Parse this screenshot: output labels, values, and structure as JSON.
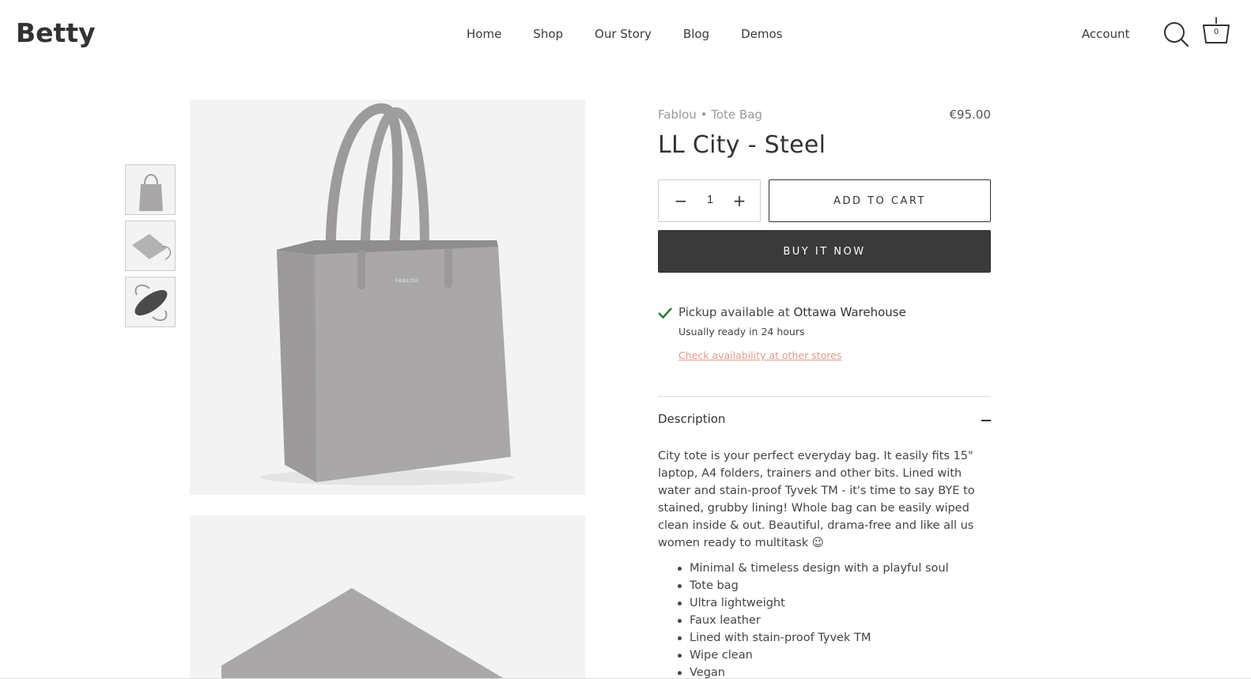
{
  "header": {
    "logo": "Betty",
    "nav": [
      "Home",
      "Shop",
      "Our Story",
      "Blog",
      "Demos"
    ],
    "account_label": "Account",
    "search_icon": "search-icon",
    "cart_icon": "cart-icon",
    "cart_count": "0"
  },
  "product": {
    "vendor": "Fablou",
    "separator": "•",
    "type": "Tote Bag",
    "price": "€95.00",
    "title": "LL City - Steel",
    "quantity": "1",
    "minus_label": "−",
    "plus_label": "+",
    "add_to_cart_label": "ADD TO CART",
    "buy_now_label": "BUY IT NOW",
    "image_logo_text": "FABLOU"
  },
  "pickup": {
    "prefix": "Pickup available at",
    "location": "Ottawa Warehouse",
    "ready": "Usually ready in 24 hours",
    "link": "Check availability at other stores",
    "check_color": "#2e7d32"
  },
  "description": {
    "title": "Description",
    "text": "City tote is your perfect everyday bag. It easily fits 15\" laptop, A4 folders, trainers and other bits. Lined with water and stain-proof Tyvek TM - it's time to say BYE to stained, grubby lining! Whole bag can be easily wiped clean inside & out. Beautiful, drama-free and like all us women ready to multitask 😉",
    "features": [
      "Minimal & timeless design with a playful soul",
      "Tote bag",
      "Ultra lightweight",
      "Faux leather",
      "Lined with stain-proof Tyvek TM",
      "Wipe clean",
      "Vegan"
    ]
  },
  "colors": {
    "accent_link": "#e09a8e",
    "buy_now_bg": "#3a3a3a",
    "bag_gray": "#a9a7a8"
  }
}
